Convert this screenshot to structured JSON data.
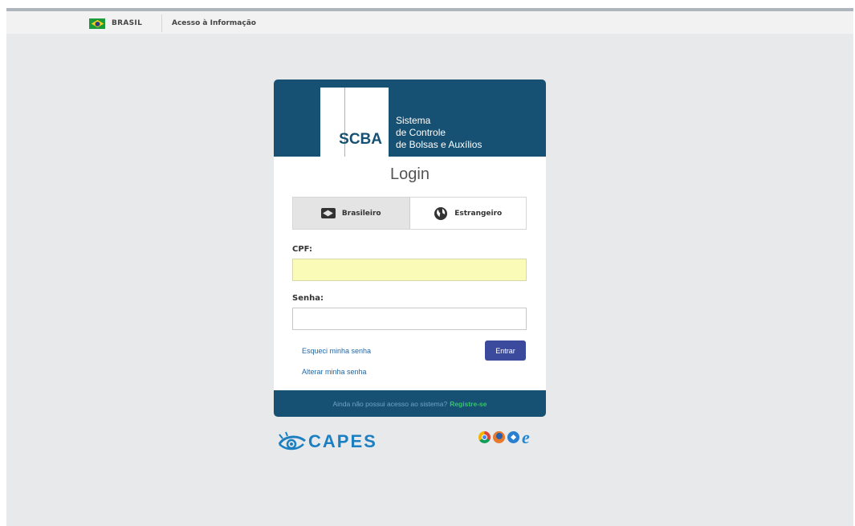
{
  "gov_bar": {
    "country": "BRASIL",
    "access_link": "Acesso à Informação"
  },
  "header": {
    "logo_abbr": "SCBA",
    "system_name_lines": [
      "Sistema",
      "de Controle",
      "de Bolsas e Auxílios"
    ]
  },
  "login": {
    "title": "Login",
    "tabs": [
      {
        "label": "Brasileiro",
        "icon": "brazil-id-icon",
        "active": true
      },
      {
        "label": "Estrangeiro",
        "icon": "globe-icon",
        "active": false
      }
    ],
    "cpf_label": "CPF:",
    "cpf_value": "",
    "senha_label": "Senha:",
    "senha_value": "",
    "forgot_password": "Esqueci minha senha",
    "change_password": "Alterar minha senha",
    "enter_button": "Entrar"
  },
  "footer": {
    "question": "Ainda não possui acesso ao sistema?",
    "register": "Registre-se"
  },
  "branding": {
    "capes": "CAPES",
    "supported_browsers": [
      "chrome-icon",
      "firefox-icon",
      "safari-icon",
      "ie-icon"
    ]
  },
  "colors": {
    "header_bg": "#165173",
    "page_bg": "#e7e9ea",
    "button_bg": "#3b4a9c",
    "register_link": "#36c46a",
    "cpf_field_bg": "#fbfbb8"
  }
}
